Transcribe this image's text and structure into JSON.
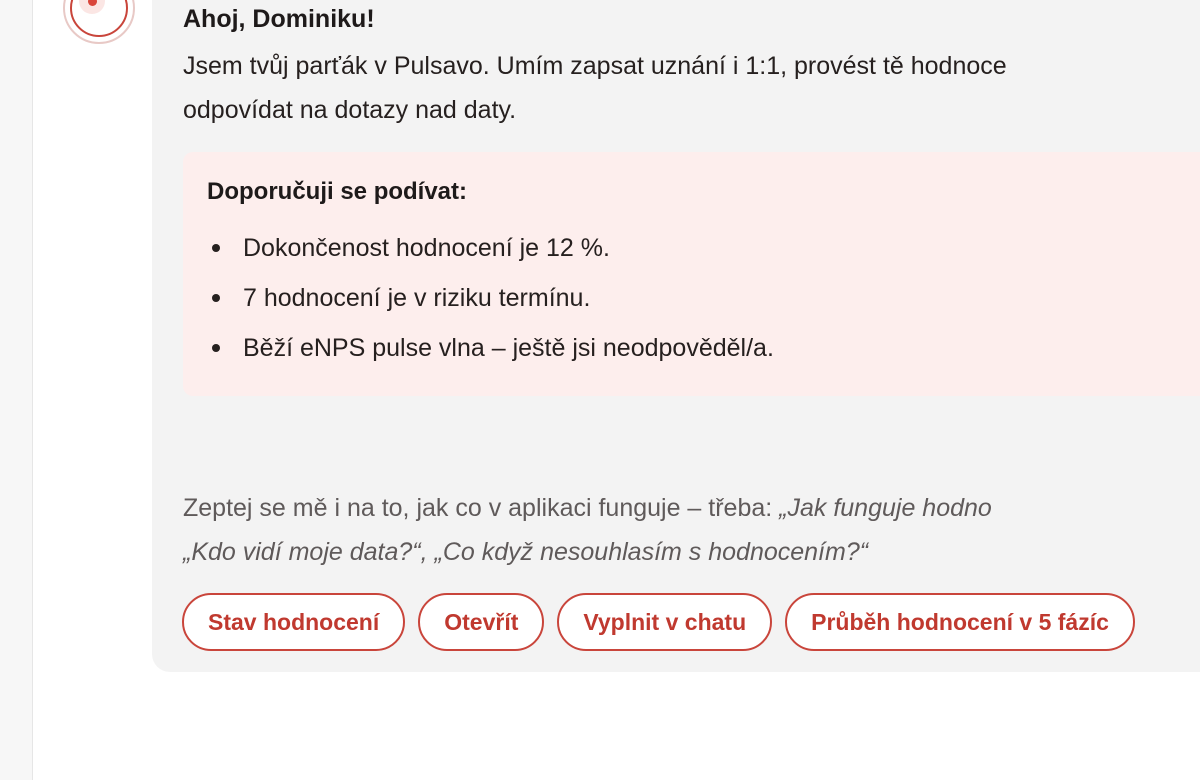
{
  "message": {
    "greeting": "Ahoj, Dominiku!",
    "intro_line1": "Jsem tvůj parťák v Pulsavo. Umím zapsat uznání i 1:1, provést tě hodnoce",
    "intro_line2": "odpovídat na dotazy nad daty.",
    "recommendations": {
      "title": "Doporučuji se podívat:",
      "items": [
        "Dokončenost hodnocení je 12 %.",
        "7 hodnocení je v riziku termínu.",
        "Běží eNPS pulse vlna – ještě jsi neodpověděl/a."
      ]
    },
    "hint": {
      "lead": "Zeptej se mě i na to, jak co v aplikaci funguje – třeba: ",
      "example1": "„Jak funguje hodno",
      "line2": "„Kdo vidí moje data?“, „Co když nesouhlasím s hodnocením?“"
    },
    "actions": [
      "Stav hodnocení",
      "Otevřít",
      "Vyplnit v chatu",
      "Průběh hodnocení v 5 fázíc"
    ]
  },
  "colors": {
    "accent": "#c9453b",
    "bubble_bg": "#f3f3f3",
    "reco_bg": "#fdeeed"
  },
  "icons": {
    "assistant_avatar": "pulse-target-icon"
  }
}
